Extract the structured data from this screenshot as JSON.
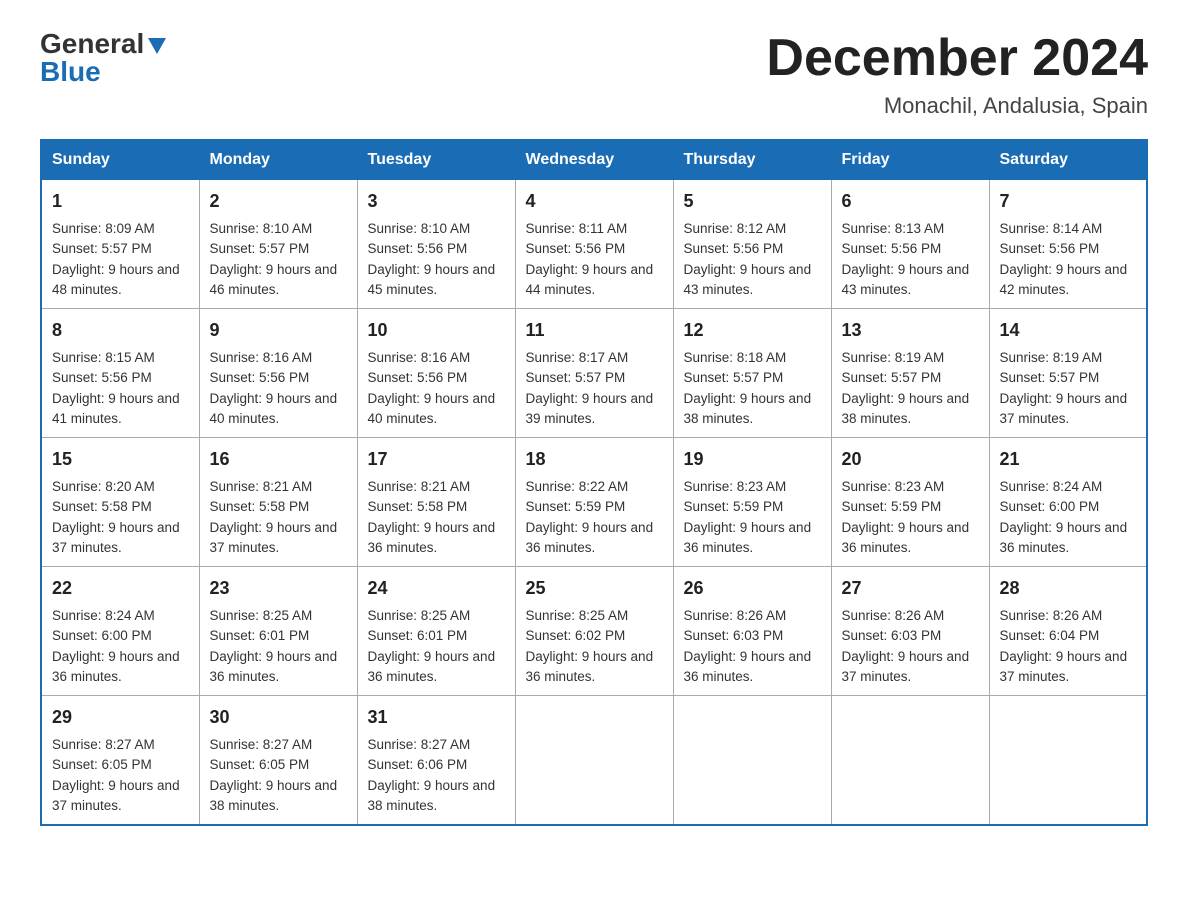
{
  "logo": {
    "general": "General",
    "blue": "Blue"
  },
  "title": "December 2024",
  "location": "Monachil, Andalusia, Spain",
  "days_of_week": [
    "Sunday",
    "Monday",
    "Tuesday",
    "Wednesday",
    "Thursday",
    "Friday",
    "Saturday"
  ],
  "weeks": [
    [
      {
        "day": "1",
        "sunrise": "8:09 AM",
        "sunset": "5:57 PM",
        "daylight": "9 hours and 48 minutes."
      },
      {
        "day": "2",
        "sunrise": "8:10 AM",
        "sunset": "5:57 PM",
        "daylight": "9 hours and 46 minutes."
      },
      {
        "day": "3",
        "sunrise": "8:10 AM",
        "sunset": "5:56 PM",
        "daylight": "9 hours and 45 minutes."
      },
      {
        "day": "4",
        "sunrise": "8:11 AM",
        "sunset": "5:56 PM",
        "daylight": "9 hours and 44 minutes."
      },
      {
        "day": "5",
        "sunrise": "8:12 AM",
        "sunset": "5:56 PM",
        "daylight": "9 hours and 43 minutes."
      },
      {
        "day": "6",
        "sunrise": "8:13 AM",
        "sunset": "5:56 PM",
        "daylight": "9 hours and 43 minutes."
      },
      {
        "day": "7",
        "sunrise": "8:14 AM",
        "sunset": "5:56 PM",
        "daylight": "9 hours and 42 minutes."
      }
    ],
    [
      {
        "day": "8",
        "sunrise": "8:15 AM",
        "sunset": "5:56 PM",
        "daylight": "9 hours and 41 minutes."
      },
      {
        "day": "9",
        "sunrise": "8:16 AM",
        "sunset": "5:56 PM",
        "daylight": "9 hours and 40 minutes."
      },
      {
        "day": "10",
        "sunrise": "8:16 AM",
        "sunset": "5:56 PM",
        "daylight": "9 hours and 40 minutes."
      },
      {
        "day": "11",
        "sunrise": "8:17 AM",
        "sunset": "5:57 PM",
        "daylight": "9 hours and 39 minutes."
      },
      {
        "day": "12",
        "sunrise": "8:18 AM",
        "sunset": "5:57 PM",
        "daylight": "9 hours and 38 minutes."
      },
      {
        "day": "13",
        "sunrise": "8:19 AM",
        "sunset": "5:57 PM",
        "daylight": "9 hours and 38 minutes."
      },
      {
        "day": "14",
        "sunrise": "8:19 AM",
        "sunset": "5:57 PM",
        "daylight": "9 hours and 37 minutes."
      }
    ],
    [
      {
        "day": "15",
        "sunrise": "8:20 AM",
        "sunset": "5:58 PM",
        "daylight": "9 hours and 37 minutes."
      },
      {
        "day": "16",
        "sunrise": "8:21 AM",
        "sunset": "5:58 PM",
        "daylight": "9 hours and 37 minutes."
      },
      {
        "day": "17",
        "sunrise": "8:21 AM",
        "sunset": "5:58 PM",
        "daylight": "9 hours and 36 minutes."
      },
      {
        "day": "18",
        "sunrise": "8:22 AM",
        "sunset": "5:59 PM",
        "daylight": "9 hours and 36 minutes."
      },
      {
        "day": "19",
        "sunrise": "8:23 AM",
        "sunset": "5:59 PM",
        "daylight": "9 hours and 36 minutes."
      },
      {
        "day": "20",
        "sunrise": "8:23 AM",
        "sunset": "5:59 PM",
        "daylight": "9 hours and 36 minutes."
      },
      {
        "day": "21",
        "sunrise": "8:24 AM",
        "sunset": "6:00 PM",
        "daylight": "9 hours and 36 minutes."
      }
    ],
    [
      {
        "day": "22",
        "sunrise": "8:24 AM",
        "sunset": "6:00 PM",
        "daylight": "9 hours and 36 minutes."
      },
      {
        "day": "23",
        "sunrise": "8:25 AM",
        "sunset": "6:01 PM",
        "daylight": "9 hours and 36 minutes."
      },
      {
        "day": "24",
        "sunrise": "8:25 AM",
        "sunset": "6:01 PM",
        "daylight": "9 hours and 36 minutes."
      },
      {
        "day": "25",
        "sunrise": "8:25 AM",
        "sunset": "6:02 PM",
        "daylight": "9 hours and 36 minutes."
      },
      {
        "day": "26",
        "sunrise": "8:26 AM",
        "sunset": "6:03 PM",
        "daylight": "9 hours and 36 minutes."
      },
      {
        "day": "27",
        "sunrise": "8:26 AM",
        "sunset": "6:03 PM",
        "daylight": "9 hours and 37 minutes."
      },
      {
        "day": "28",
        "sunrise": "8:26 AM",
        "sunset": "6:04 PM",
        "daylight": "9 hours and 37 minutes."
      }
    ],
    [
      {
        "day": "29",
        "sunrise": "8:27 AM",
        "sunset": "6:05 PM",
        "daylight": "9 hours and 37 minutes."
      },
      {
        "day": "30",
        "sunrise": "8:27 AM",
        "sunset": "6:05 PM",
        "daylight": "9 hours and 38 minutes."
      },
      {
        "day": "31",
        "sunrise": "8:27 AM",
        "sunset": "6:06 PM",
        "daylight": "9 hours and 38 minutes."
      },
      null,
      null,
      null,
      null
    ]
  ]
}
